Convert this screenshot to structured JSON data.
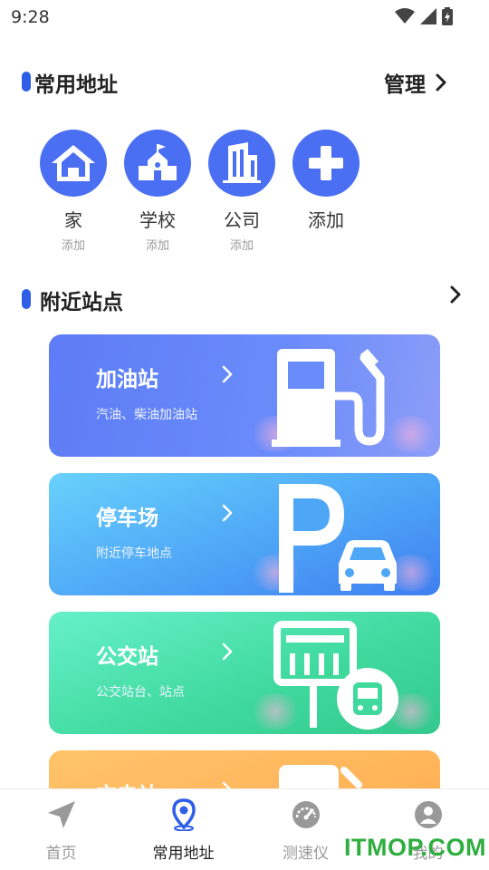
{
  "status_bar": {
    "time": "9:28"
  },
  "favorites": {
    "title": "常用地址",
    "manage_label": "管理",
    "items": [
      {
        "label": "家",
        "sub": "添加",
        "icon": "house-icon"
      },
      {
        "label": "学校",
        "sub": "添加",
        "icon": "school-icon"
      },
      {
        "label": "公司",
        "sub": "添加",
        "icon": "building-icon"
      },
      {
        "label": "添加",
        "sub": "",
        "icon": "plus-icon"
      }
    ]
  },
  "nearby": {
    "title": "附近站点",
    "cards": [
      {
        "title": "加油站",
        "sub": "汽油、柴油加油站",
        "icon": "fuel-pump-icon"
      },
      {
        "title": "停车场",
        "sub": "附近停车地点",
        "icon": "parking-icon"
      },
      {
        "title": "公交站",
        "sub": "公交站台、站点",
        "icon": "bus-stop-icon"
      },
      {
        "title": "充电站",
        "sub": "",
        "icon": "charging-station-icon"
      }
    ]
  },
  "tabs": [
    {
      "label": "首页",
      "icon": "navigation-arrow-icon",
      "active": false
    },
    {
      "label": "常用地址",
      "icon": "location-pin-icon",
      "active": true
    },
    {
      "label": "测速仪",
      "icon": "speedometer-icon",
      "active": false
    },
    {
      "label": "我的",
      "icon": "user-icon",
      "active": false
    }
  ],
  "watermark": "ITMOP.COM",
  "colors": {
    "accent": "#2f5ee8",
    "icon_blue": "#4b6ff2",
    "gas": "#6a8cfa",
    "park": "#4ea6f7",
    "bus": "#3fd99e",
    "charge": "#ffaa4d"
  }
}
